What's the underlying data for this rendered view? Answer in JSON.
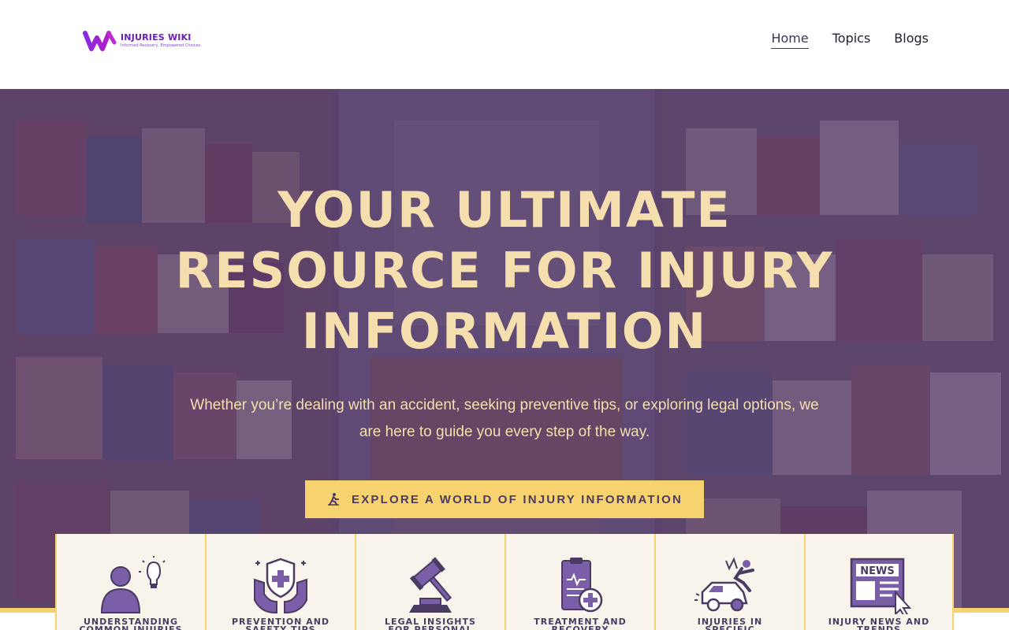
{
  "brand": {
    "name": "INJURIES WIKI",
    "tagline": "Informed Recovery, Empowered Choices.",
    "primary_color": "#6a1fb3"
  },
  "nav": {
    "items": [
      {
        "label": "Home",
        "active": true
      },
      {
        "label": "Topics",
        "active": false
      },
      {
        "label": "Blogs",
        "active": false
      }
    ]
  },
  "hero": {
    "title": "YOUR ULTIMATE RESOURCE FOR INJURY INFORMATION",
    "subtitle": "Whether you’re dealing with an accident, seeking preventive tips, or exploring legal options, we are here to guide you every step of the way.",
    "cta_label": "EXPLORE A WORLD OF INJURY INFORMATION",
    "cta_icon": "hiking-icon",
    "accent_color": "#f6d36f",
    "title_color": "#f6dfae",
    "overlay_color": "#543a6e"
  },
  "cards": [
    {
      "title": "UNDERSTANDING COMMON INJURIES",
      "icon": "person-lightbulb-icon"
    },
    {
      "title": "PREVENTION AND SAFETY TIPS",
      "icon": "shield-hands-icon"
    },
    {
      "title": "LEGAL INSIGHTS FOR PERSONAL INJURY",
      "icon": "gavel-icon"
    },
    {
      "title": "TREATMENT AND RECOVERY",
      "icon": "medical-clipboard-icon"
    },
    {
      "title": "INJURIES IN SPECIFIC CONTEXTS",
      "icon": "car-accident-icon"
    },
    {
      "title": "INJURY NEWS AND TRENDS",
      "icon": "news-icon"
    }
  ]
}
